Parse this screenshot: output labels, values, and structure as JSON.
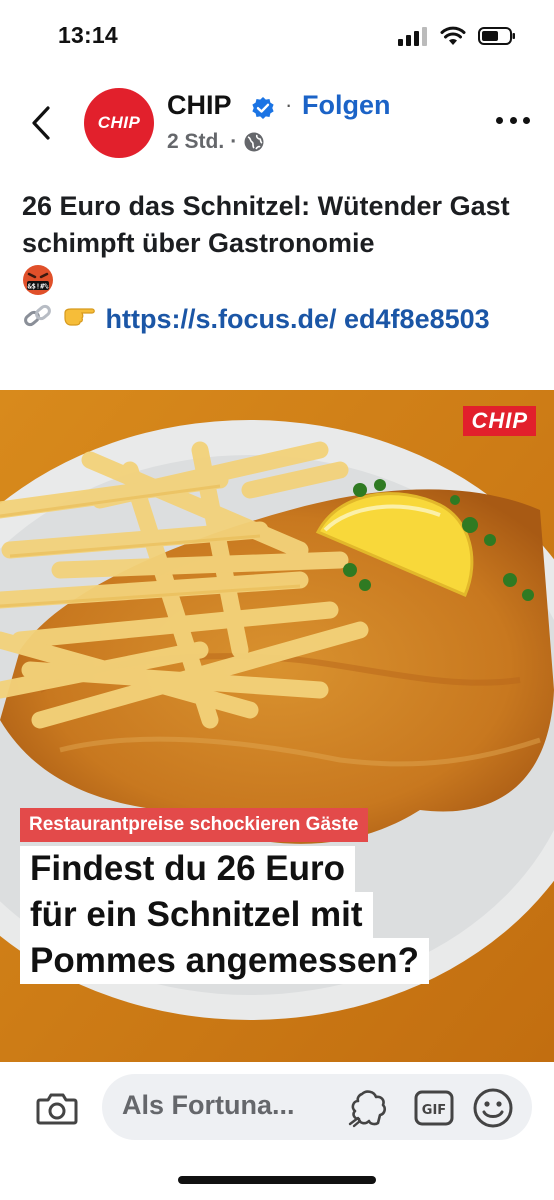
{
  "status_bar": {
    "time": "13:14",
    "icons": [
      "cellular-signal-icon",
      "wifi-icon",
      "battery-icon"
    ]
  },
  "header": {
    "back_icon": "chevron-left-icon",
    "page_name": "CHIP",
    "avatar_text": "CHIP",
    "verified_icon": "verified-badge-icon",
    "separator": "·",
    "follow_label": "Folgen",
    "time_ago": "2 Std.",
    "time_separator": "·",
    "audience_icon": "globe-icon",
    "more_icon": "more-dots-icon"
  },
  "post": {
    "text": "26 Euro das Schnitzel: Wütender Gast schimpft über Gastronomie",
    "emoji": "angry-swearing-face-emoji",
    "link_icons": [
      "link-emoji",
      "pointing-right-emoji"
    ],
    "link_text": "https://s.focus.de/ ed4f8e8503"
  },
  "image": {
    "watermark": "CHIP",
    "tag": "Restaurantpreise schockieren Gäste",
    "headline_lines": [
      "Findest du 26 Euro",
      "für ein Schnitzel mit",
      "Pommes angemessen?"
    ],
    "description_icon": "schnitzel-with-fries-photo"
  },
  "comment_bar": {
    "placeholder": "Als Fortuna...",
    "camera_icon": "camera-icon",
    "sticker_icon": "avatar-sticker-icon",
    "gif_label": "GIF",
    "emoji_icon": "smiley-icon"
  },
  "colors": {
    "brand_red": "#e2202c",
    "follow_blue": "#1b63c7",
    "link_blue": "#1b56a6",
    "tag_red": "#e34a4a"
  }
}
